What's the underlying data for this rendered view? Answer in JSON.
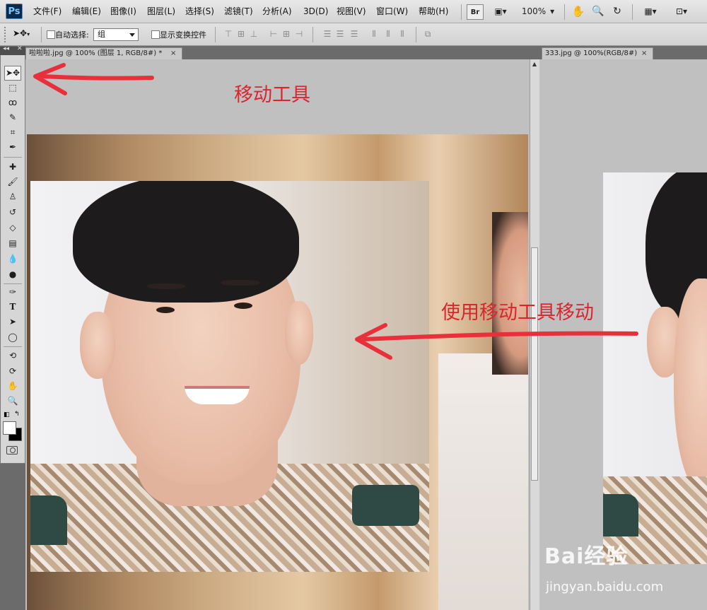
{
  "app": {
    "logo": "Ps"
  },
  "menu": [
    "文件(F)",
    "编辑(E)",
    "图像(I)",
    "图层(L)",
    "选择(S)",
    "滤镜(T)",
    "分析(A)",
    "3D(D)",
    "视图(V)",
    "窗口(W)",
    "帮助(H)"
  ],
  "menubar_extras": {
    "bridge_label": "Br",
    "zoom_value": "100%"
  },
  "options": {
    "auto_select_label": "自动选择:",
    "auto_select_value": "组",
    "show_transform_label": "显示变换控件"
  },
  "tabs": {
    "doc1": "啦啦啦.jpg @ 100% (图层 1, RGB/8#) *",
    "doc2": "333.jpg @ 100%(RGB/8#)",
    "close_glyph": "×"
  },
  "annotations": {
    "move_tool": "移动工具",
    "use_move_tool": "使用移动工具移动",
    "color": "#d8262e"
  },
  "watermark": {
    "logo": "Bai经验",
    "url": "jingyan.baidu.com"
  },
  "tools": [
    "move-icon",
    "marquee-icon",
    "lasso-icon",
    "quick-select-icon",
    "crop-icon",
    "eyedropper-icon",
    "healing-brush-icon",
    "brush-icon",
    "clone-stamp-icon",
    "history-brush-icon",
    "eraser-icon",
    "gradient-icon",
    "blur-icon",
    "dodge-icon",
    "pen-icon",
    "type-icon",
    "path-select-icon",
    "shape-icon",
    "rotate-3d-icon",
    "orbit-3d-icon",
    "hand-icon",
    "zoom-icon"
  ]
}
